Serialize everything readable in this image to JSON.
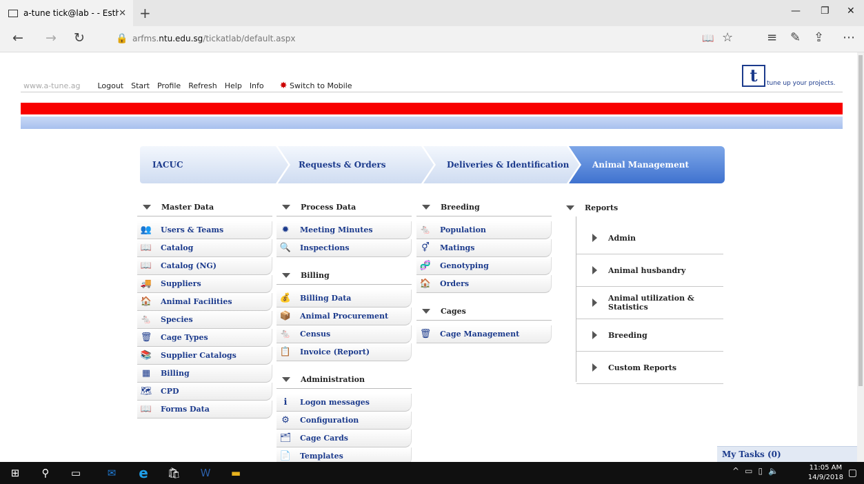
{
  "browser": {
    "tab_title": "a-tune tick@lab - - Esth",
    "tab_close": "✕",
    "new_tab": "+",
    "win_min": "—",
    "win_max": "❐",
    "win_close": "✕",
    "url_prefix": "arfms.",
    "url_host": "ntu.edu.sg",
    "url_path": "/tickatlab/default.aspx",
    "back": "←",
    "forward": "→",
    "refresh": "↻",
    "reading": "📖",
    "favorite": "☆",
    "hub": "≡",
    "notes": "✎",
    "share": "⇪",
    "more": "⋯"
  },
  "header": {
    "site_link": "www.a-tune.ag",
    "links": [
      "Logout",
      "Start",
      "Profile",
      "Refresh",
      "Help",
      "Info"
    ],
    "mobile_label": "Switch to Mobile",
    "logo_mark": "t",
    "logo_tagline": "tune up your projects."
  },
  "workflow": {
    "steps": [
      "IACUC",
      "Requests & Orders",
      "Deliveries & Identification",
      "Animal Management"
    ]
  },
  "col1": {
    "title": "Master Data",
    "items": [
      {
        "icon": "👥",
        "label": "Users & Teams"
      },
      {
        "icon": "📖",
        "label": "Catalog"
      },
      {
        "icon": "📖",
        "label": "Catalog (NG)"
      },
      {
        "icon": "🚚",
        "label": "Suppliers"
      },
      {
        "icon": "🏠",
        "label": "Animal Facilities"
      },
      {
        "icon": "🐁",
        "label": "Species"
      },
      {
        "icon": "🗑",
        "label": "Cage Types"
      },
      {
        "icon": "📚",
        "label": "Supplier Catalogs"
      },
      {
        "icon": "▦",
        "label": "Billing"
      },
      {
        "icon": "🗺",
        "label": "CPD"
      },
      {
        "icon": "📖",
        "label": "Forms Data"
      }
    ]
  },
  "col2": {
    "process_title": "Process Data",
    "process_items": [
      {
        "icon": "✹",
        "label": "Meeting Minutes"
      },
      {
        "icon": "🔍",
        "label": "Inspections"
      }
    ],
    "billing_title": "Billing",
    "billing_items": [
      {
        "icon": "💰",
        "label": "Billing Data"
      },
      {
        "icon": "📦",
        "label": "Animal Procurement"
      },
      {
        "icon": "🐁",
        "label": "Census"
      },
      {
        "icon": "📋",
        "label": "Invoice (Report)"
      }
    ],
    "admin_title": "Administration",
    "admin_items": [
      {
        "icon": "ℹ",
        "label": "Logon messages"
      },
      {
        "icon": "⚙",
        "label": "Configuration"
      },
      {
        "icon": "🗂",
        "label": "Cage Cards"
      },
      {
        "icon": "📄",
        "label": "Templates"
      }
    ]
  },
  "col3": {
    "breeding_title": "Breeding",
    "breeding_items": [
      {
        "icon": "🐁",
        "label": "Population"
      },
      {
        "icon": "⚥",
        "label": "Matings"
      },
      {
        "icon": "🧬",
        "label": "Genotyping"
      },
      {
        "icon": "🏠",
        "label": "Orders"
      }
    ],
    "cages_title": "Cages",
    "cages_items": [
      {
        "icon": "🗑",
        "label": "Cage Management"
      }
    ]
  },
  "reports": {
    "title": "Reports",
    "items": [
      "Admin",
      "Animal husbandry",
      "Animal utilization & Statistics",
      "Breeding",
      "Custom Reports"
    ]
  },
  "tasks": {
    "label": "My Tasks (0)"
  },
  "taskbar": {
    "time": "11:05 AM",
    "date": "14/9/2018"
  }
}
